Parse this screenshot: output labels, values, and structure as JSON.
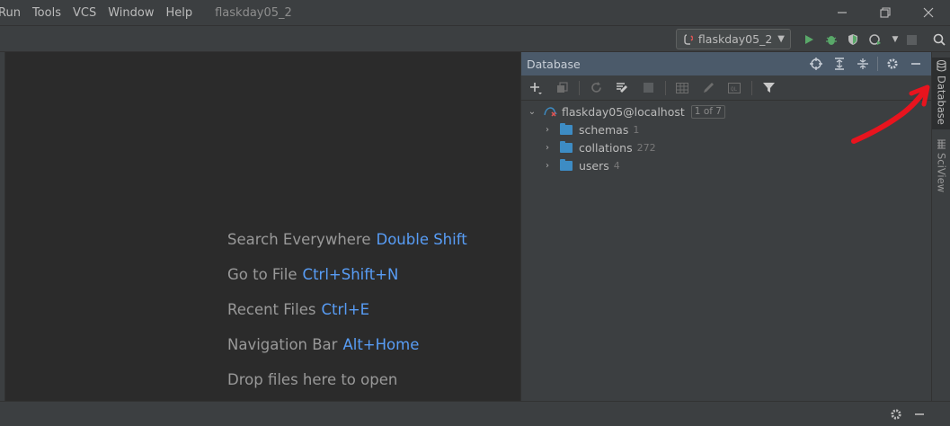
{
  "menu": {
    "items": [
      "Run",
      "Tools",
      "VCS",
      "Window",
      "Help"
    ],
    "window_title": "flaskday05_2"
  },
  "window_controls": {
    "minimize_icon": "minimize-icon",
    "restore_icon": "restore-icon",
    "close_icon": "close-icon"
  },
  "toolbar": {
    "run_config_label": "flaskday05_2",
    "run_color": "#59a869",
    "debug_color": "#59a869"
  },
  "editor": {
    "hints": [
      {
        "label": "Search Everywhere",
        "shortcut": "Double Shift"
      },
      {
        "label": "Go to File",
        "shortcut": "Ctrl+Shift+N"
      },
      {
        "label": "Recent Files",
        "shortcut": "Ctrl+E"
      },
      {
        "label": "Navigation Bar",
        "shortcut": "Alt+Home"
      },
      {
        "label": "Drop files here to open",
        "shortcut": ""
      }
    ]
  },
  "database": {
    "title": "Database",
    "datasource": {
      "name": "flaskday05@localhost",
      "badge": "1 of 7"
    },
    "children": [
      {
        "name": "schemas",
        "count": "1"
      },
      {
        "name": "collations",
        "count": "272"
      },
      {
        "name": "users",
        "count": "4"
      }
    ]
  },
  "right_stripe": {
    "tabs": [
      "Database",
      "SciView"
    ]
  },
  "colors": {
    "accent": "#589df6",
    "panel_header": "#4b5a6a",
    "folder": "#3d8cc4",
    "annotation": "#e8141e"
  }
}
